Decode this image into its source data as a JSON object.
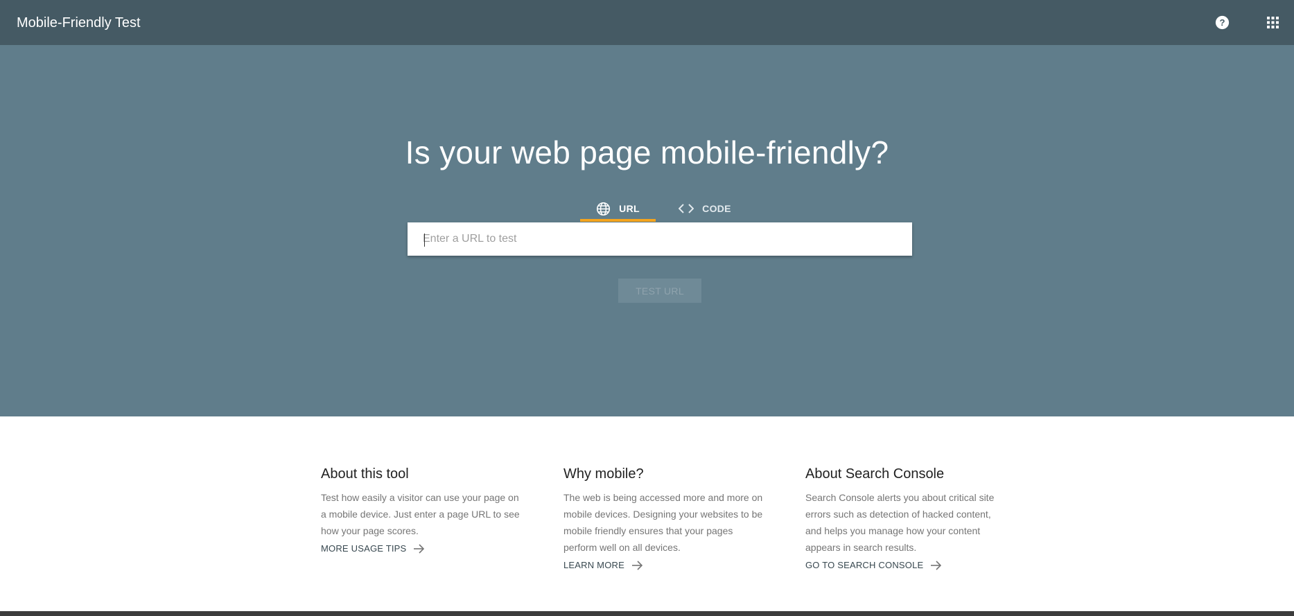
{
  "header": {
    "title": "Mobile-Friendly Test",
    "help_icon": "help-circle-icon",
    "apps_icon": "apps-grid-icon"
  },
  "hero": {
    "title": "Is your web page mobile-friendly?",
    "tabs": [
      {
        "label": "URL",
        "icon": "globe-icon",
        "active": true
      },
      {
        "label": "CODE",
        "icon": "code-icon",
        "active": false
      }
    ],
    "input": {
      "placeholder": "Enter a URL to test",
      "value": ""
    },
    "button_label": "TEST URL"
  },
  "info": [
    {
      "title": "About this tool",
      "text": "Test how easily a visitor can use your page on a mobile device. Just enter a page URL to see how your page scores.",
      "link": "MORE USAGE TIPS"
    },
    {
      "title": "Why mobile?",
      "text": "The web is being accessed more and more on mobile devices. Designing your websites to be mobile friendly ensures that your pages perform well on all devices.",
      "link": "LEARN MORE"
    },
    {
      "title": "About Search Console",
      "text": "Search Console alerts you about critical site errors such as detection of hacked content, and helps you manage how your content appears in search results.",
      "link": "GO TO SEARCH CONSOLE"
    }
  ],
  "colors": {
    "header_bg": "#455a64",
    "hero_bg": "#607d8b",
    "tab_indicator": "#f4a41e"
  }
}
